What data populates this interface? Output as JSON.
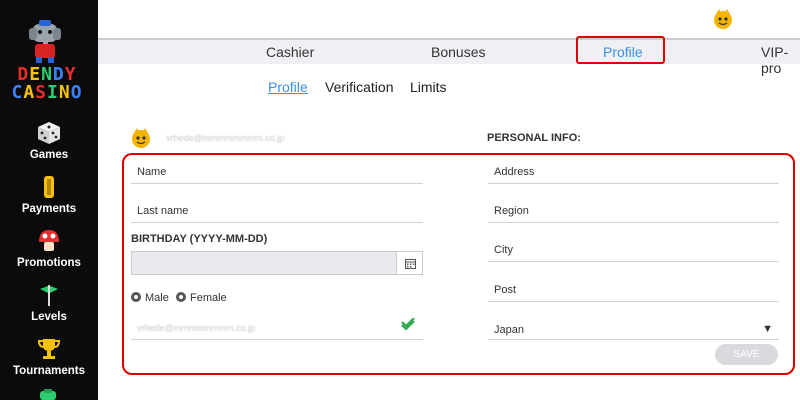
{
  "brand": {
    "logo_line1": "DENDY",
    "logo_line2": "CASINO"
  },
  "sidebar": {
    "items": [
      {
        "label": "Games",
        "icon": "dice-icon"
      },
      {
        "label": "Payments",
        "icon": "coin-icon"
      },
      {
        "label": "Promotions",
        "icon": "mushroom-icon"
      },
      {
        "label": "Levels",
        "icon": "flag-icon"
      },
      {
        "label": "Tournaments",
        "icon": "trophy-icon"
      }
    ]
  },
  "tabs": [
    {
      "label": "Cashier"
    },
    {
      "label": "Bonuses"
    },
    {
      "label": "Profile",
      "active": true
    },
    {
      "label": "VIP-pro"
    }
  ],
  "subtabs": [
    {
      "label": "Profile",
      "active": true
    },
    {
      "label": "Verification"
    },
    {
      "label": "Limits"
    }
  ],
  "profile": {
    "email_blurred": "vrhede@mmmmmmmm.co.jp",
    "personal_info_label": "PERSONAL INFO:",
    "name_placeholder": "Name",
    "lastname_placeholder": "Last name",
    "birthday_label": "BIRTHDAY (YYYY-MM-DD)",
    "gender_male": "Male",
    "gender_female": "Female",
    "email_field_blurred": "vrhede@mmmmmmmm.co.jp",
    "address_placeholder": "Address",
    "region_placeholder": "Region",
    "city_placeholder": "City",
    "post_placeholder": "Post",
    "country_value": "Japan",
    "save_label": "SAVE"
  },
  "colors": {
    "accent": "#3b8fdc",
    "highlight": "#e00000",
    "sidebar_bg": "#0b0b0b"
  }
}
